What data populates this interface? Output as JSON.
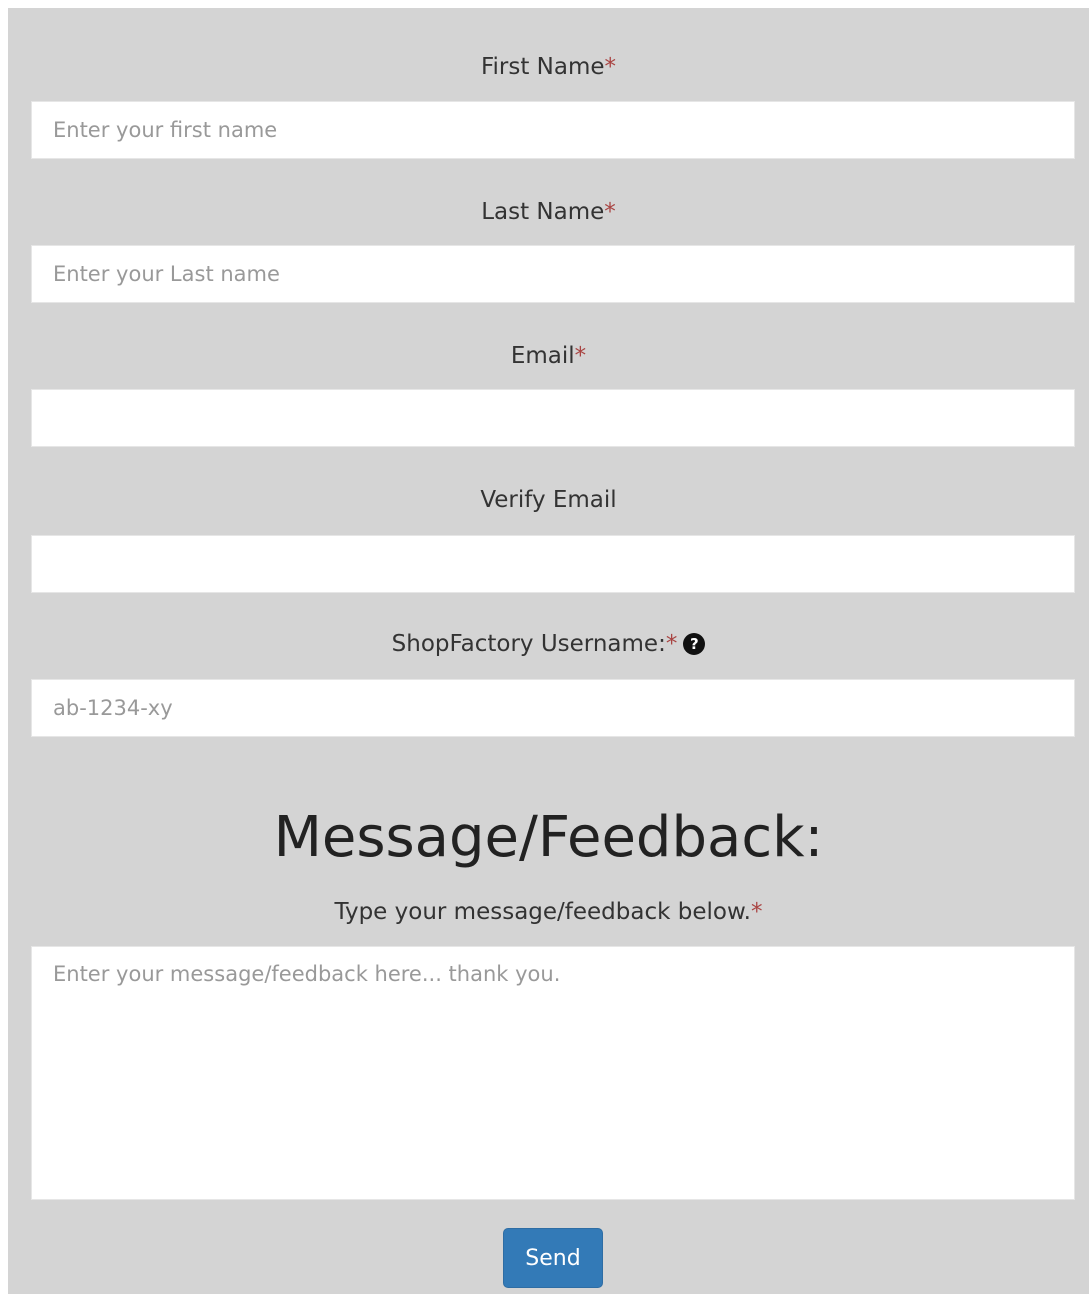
{
  "form": {
    "first_name": {
      "label": "First Name",
      "required_mark": "*",
      "placeholder": "Enter your first name",
      "value": ""
    },
    "last_name": {
      "label": "Last Name",
      "required_mark": "*",
      "placeholder": "Enter your Last name",
      "value": ""
    },
    "email": {
      "label": "Email",
      "required_mark": "*",
      "placeholder": "",
      "value": ""
    },
    "verify_email": {
      "label": "Verify Email",
      "placeholder": "",
      "value": ""
    },
    "username": {
      "label": "ShopFactory Username:",
      "required_mark": "*",
      "help_icon": "?",
      "placeholder": "ab-1234-xy",
      "value": ""
    },
    "message": {
      "heading": "Message/Feedback:",
      "label": "Type your message/feedback below.",
      "required_mark": "*",
      "placeholder": "Enter your message/feedback here... thank you.",
      "value": ""
    },
    "send_label": "Send"
  },
  "colors": {
    "panel_background": "#d4d4d4",
    "required_mark": "#a94442",
    "button_primary": "#337ab7"
  },
  "icons": {
    "help": "question-circle-icon"
  }
}
